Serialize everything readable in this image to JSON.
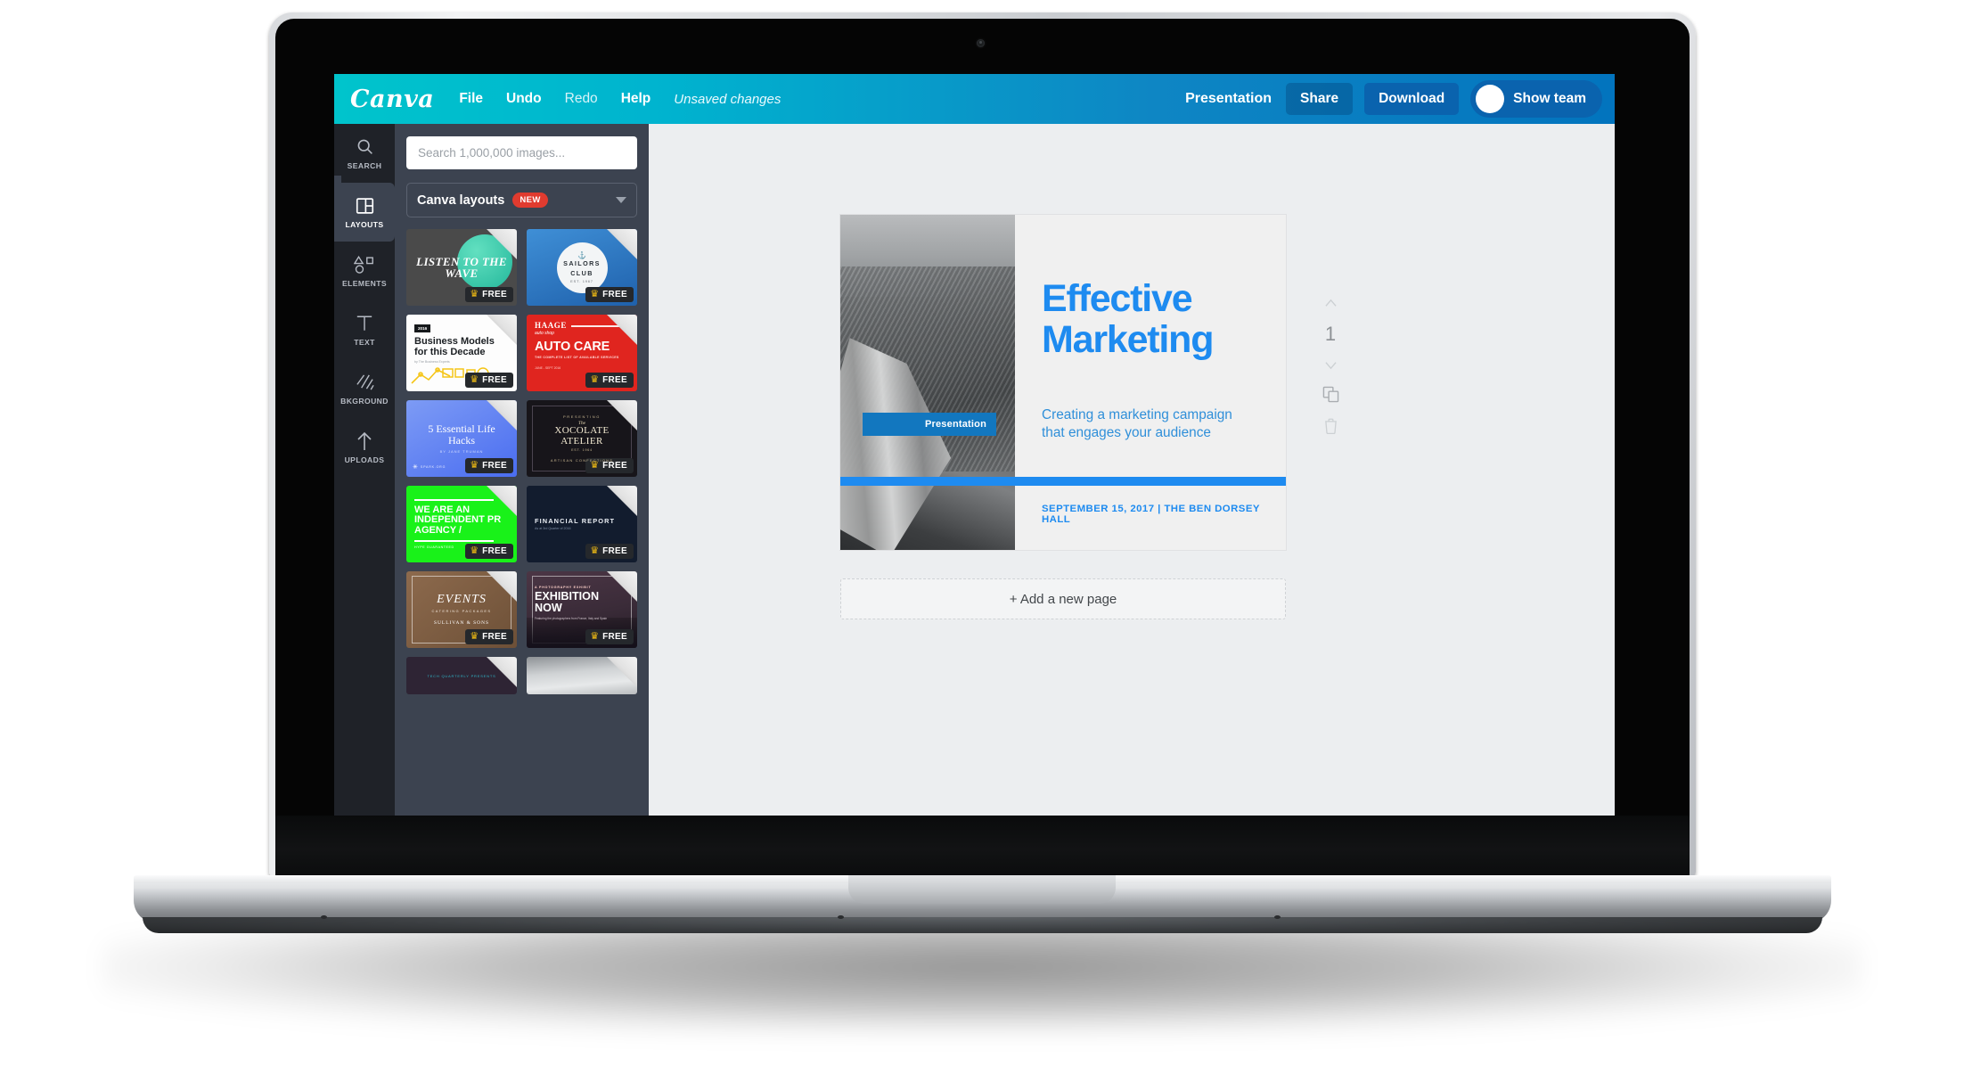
{
  "app": {
    "brand": "Canva"
  },
  "toolbar": {
    "menu": [
      {
        "label": "File",
        "dim": false
      },
      {
        "label": "Undo",
        "dim": false
      },
      {
        "label": "Redo",
        "dim": true
      },
      {
        "label": "Help",
        "dim": false
      }
    ],
    "status": "Unsaved changes",
    "doc_title": "Presentation",
    "share_label": "Share",
    "download_label": "Download",
    "team_label": "Show team"
  },
  "rail": {
    "items": [
      {
        "label": "SEARCH",
        "icon": "search-icon",
        "active": false
      },
      {
        "label": "LAYOUTS",
        "icon": "layouts-icon",
        "active": true
      },
      {
        "label": "ELEMENTS",
        "icon": "elements-icon",
        "active": false
      },
      {
        "label": "TEXT",
        "icon": "text-icon",
        "active": false
      },
      {
        "label": "BKGROUND",
        "icon": "background-icon",
        "active": false
      },
      {
        "label": "UPLOADS",
        "icon": "uploads-icon",
        "active": false
      }
    ]
  },
  "panel": {
    "search_placeholder": "Search 1,000,000 images...",
    "layouts_label": "Canva layouts",
    "layouts_badge": "NEW",
    "free_tag": "FREE",
    "templates": [
      {
        "name": "listen-to-the-wave",
        "title": "LISTEN TO THE WAVE",
        "free": true
      },
      {
        "name": "sailors-club",
        "title": "SAILORS CLUB",
        "subtitle": "EST. 1967",
        "free": true
      },
      {
        "name": "business-models-for-this-decade",
        "title": "Business Models for this Decade",
        "subtitle": "by The Business Experts",
        "eyebrow": "2016",
        "free": true
      },
      {
        "name": "haage-auto-care",
        "title": "AUTO CARE",
        "eyebrow": "HAAGE",
        "eyebrow2": "auto shop",
        "subtitle": "THE COMPLETE LIST OF AVAILABLE SERVICES",
        "footer": "JUNE - SEPT 2016",
        "free": true
      },
      {
        "name": "5-essential-life-hacks",
        "title": "5 Essential Life Hacks",
        "subtitle": "BY JANE TRUMAN",
        "footer": "SPARK.ORG",
        "free": true
      },
      {
        "name": "xocolate-atelier",
        "title": "XOCOLATE ATELIER",
        "eyebrow": "PRESENTING",
        "eyebrow2": "The",
        "subtitle": "EST. 1964",
        "footer": "ARTISAN CONFECTIONS",
        "free": true
      },
      {
        "name": "independent-pr-agency",
        "title": "WE ARE AN INDEPENDENT PR AGENCY /",
        "footer": "HYPE GUARANTEED",
        "free": true
      },
      {
        "name": "financial-report",
        "title": "FINANCIAL REPORT",
        "subtitle": "As at 3rd Quarter of 2016",
        "free": true
      },
      {
        "name": "events-catering-packages",
        "title": "EVENTS",
        "subtitle": "CATERING PACKAGES",
        "footer": "SULLIVAN & SONS",
        "free": true
      },
      {
        "name": "exhibition-now",
        "title": "EXHIBITION NOW",
        "eyebrow": "A PHOTOGRAPHY EXHIBIT",
        "subtitle": "Featuring the photographers from France, Italy and Spain",
        "free": true
      },
      {
        "name": "dark-teaser-template",
        "title": "TECH QUARTERLY PRESENTS",
        "free": false
      },
      {
        "name": "mountain-photo-template",
        "title": "",
        "free": false
      }
    ]
  },
  "editor": {
    "slide": {
      "chip_label": "Presentation",
      "title_line1": "Effective",
      "title_line2": "Marketing",
      "subtitle_line1": "Creating a marketing campaign",
      "subtitle_line2": "that engages your audience",
      "footer": "SEPTEMBER 15, 2017  |  THE BEN DORSEY HALL"
    },
    "page_tools": {
      "move_up": "move-up-icon",
      "page_number": "1",
      "move_down": "move-down-icon",
      "duplicate": "duplicate-icon",
      "delete": "trash-icon"
    },
    "add_page_label": "+ Add a new page"
  },
  "colors": {
    "brand_teal": "#00c4cc",
    "brand_blue": "#0274be",
    "accent_blue": "#1e8bf0",
    "chip_blue": "#1277bf",
    "badge_red": "#e03b2f",
    "panel_bg": "#3c4350",
    "rail_bg": "#1f2228"
  }
}
